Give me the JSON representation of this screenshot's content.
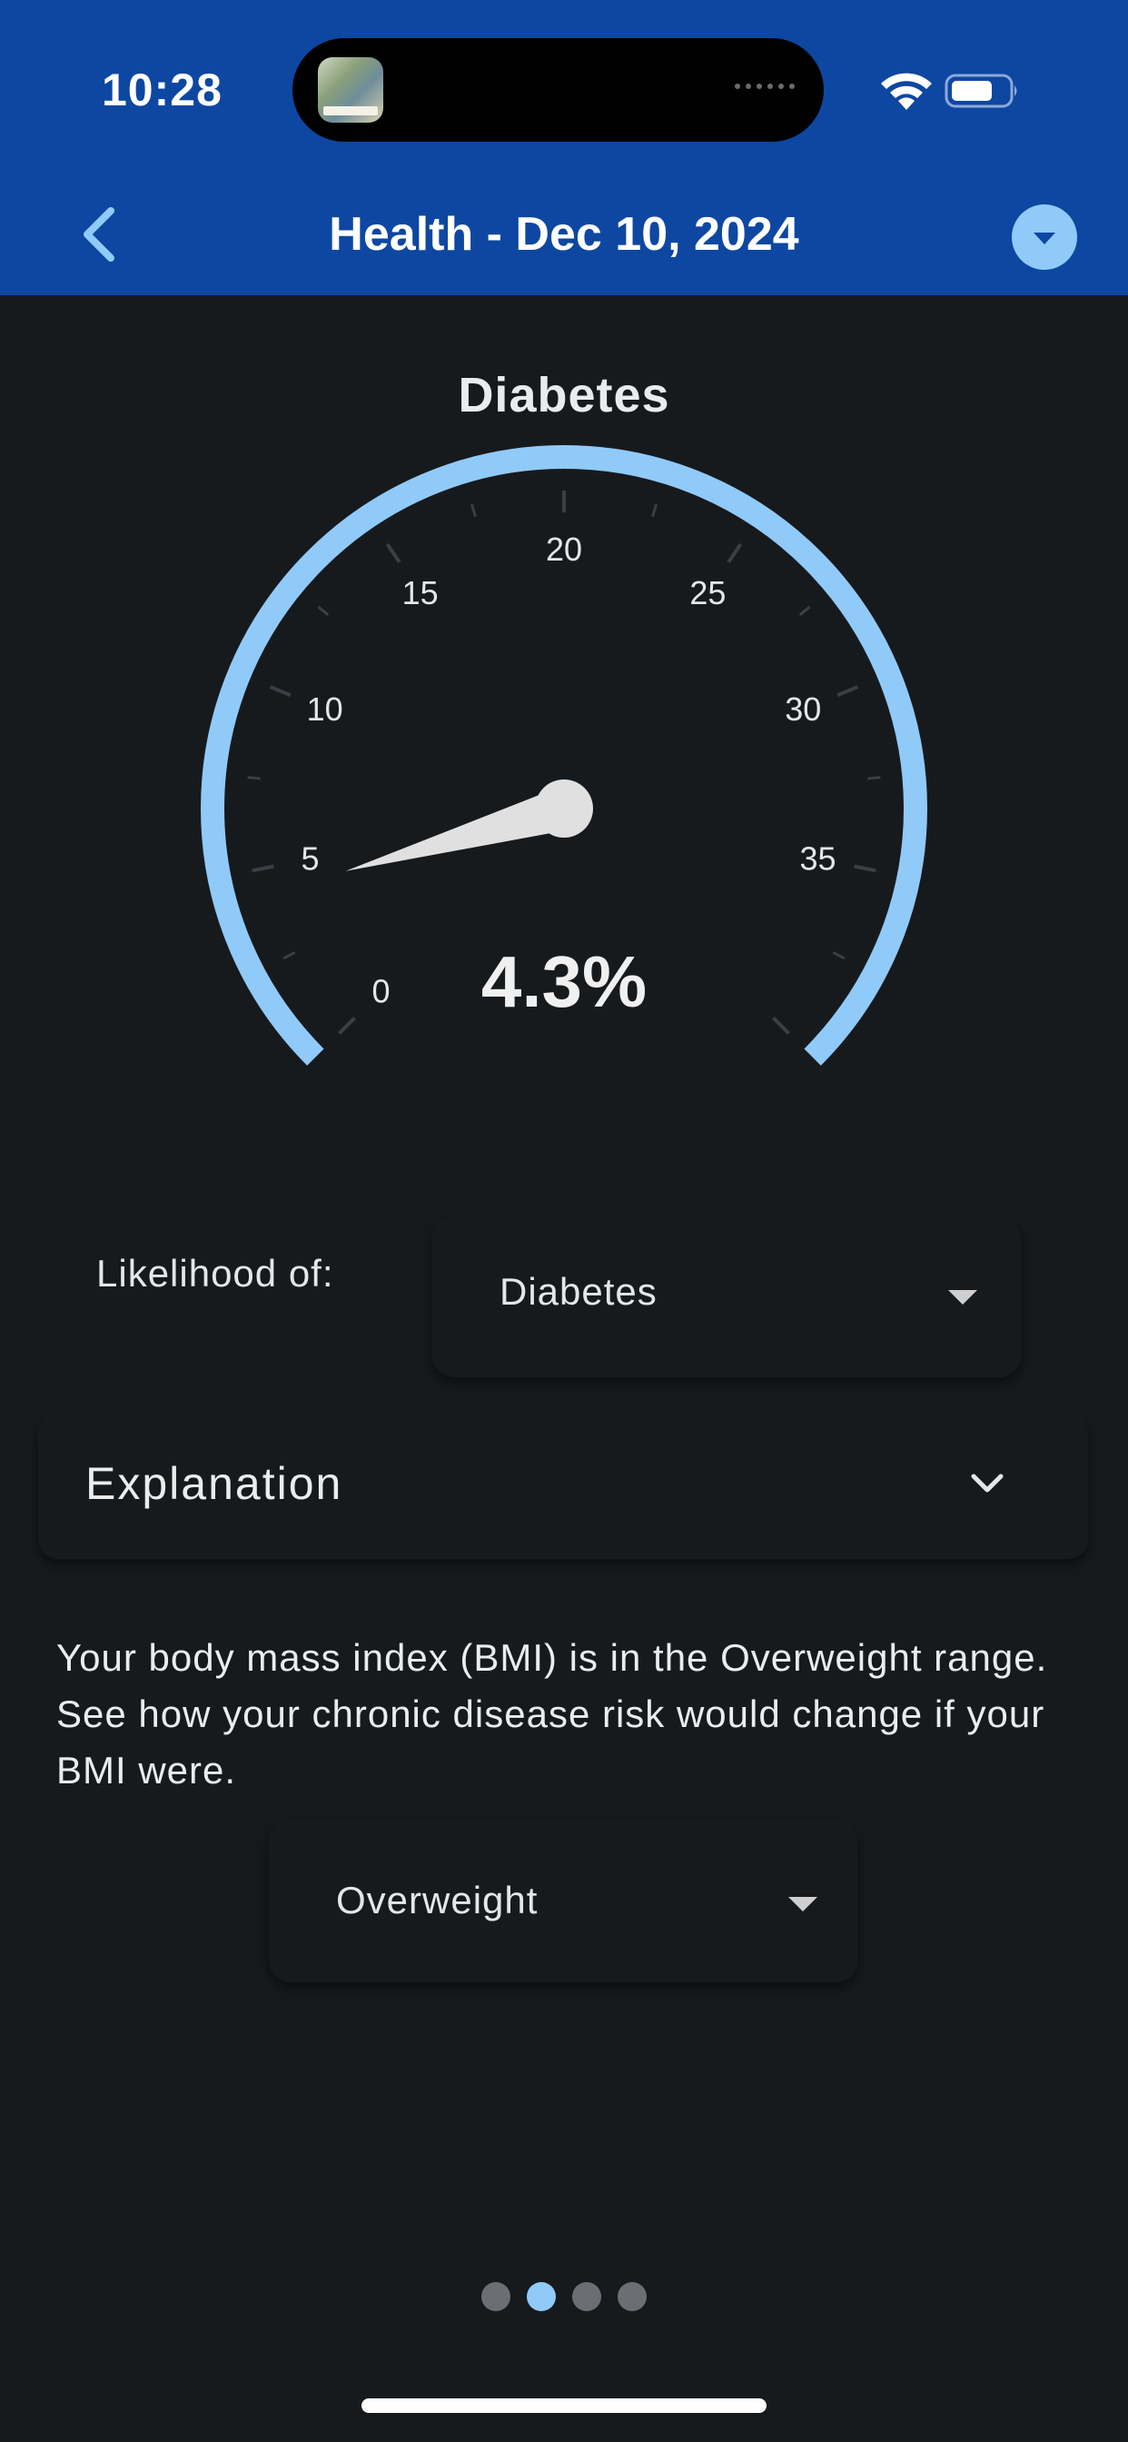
{
  "status_bar": {
    "time": "10:28"
  },
  "header": {
    "title": "Health - Dec 10, 2024"
  },
  "gauge": {
    "title": "Diabetes",
    "value_text": "4.3%",
    "value": 4.3,
    "min": 0,
    "max": 40,
    "tick_labels": [
      "0",
      "5",
      "10",
      "15",
      "20",
      "25",
      "30",
      "35"
    ],
    "arc_color": "#90caf9",
    "needle_color": "#e0e0e0"
  },
  "likelihood": {
    "label": "Likelihood of:",
    "selected": "Diabetes"
  },
  "explanation": {
    "label": "Explanation"
  },
  "bmi_text": "Your body mass index (BMI) is in the Overweight range. See how your chronic disease risk would change if your BMI were.",
  "bmi_dropdown": {
    "selected": "Overweight"
  },
  "pager": {
    "count": 4,
    "active_index": 1
  },
  "colors": {
    "header": "#0d47a1",
    "background": "#171a1d",
    "accent": "#90caf9"
  }
}
